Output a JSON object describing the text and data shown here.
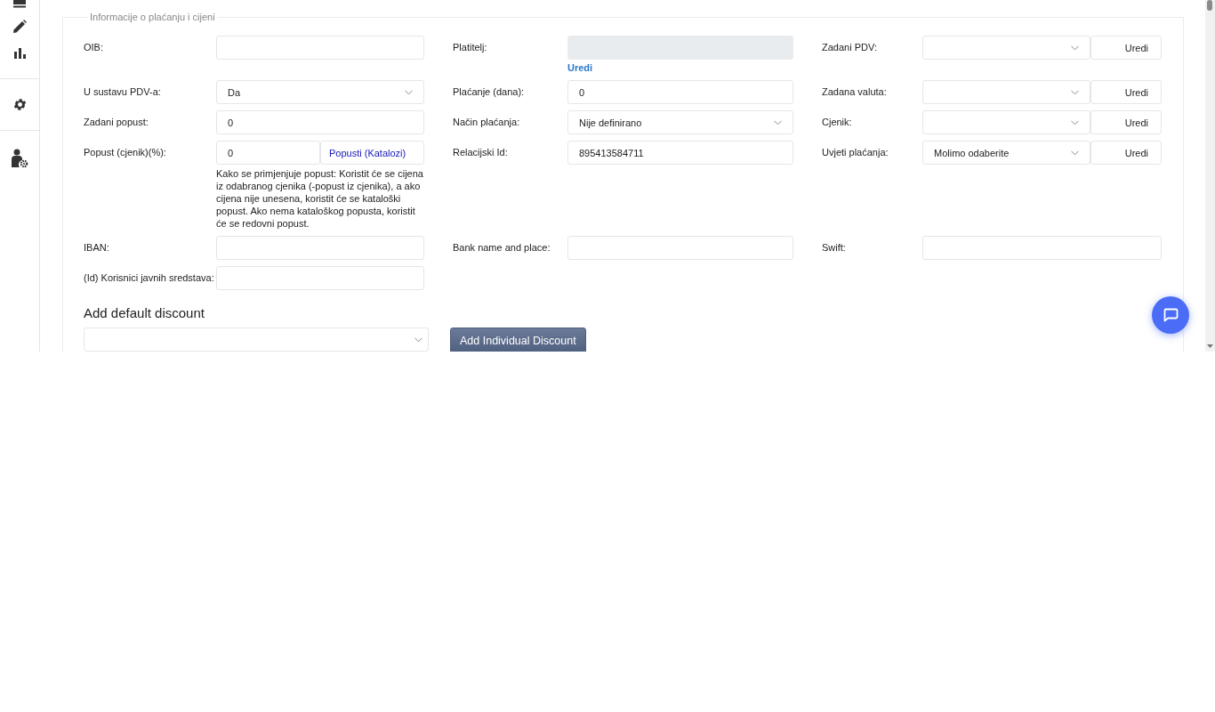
{
  "fieldset": {
    "legend": "Informacije o plaćanju i cijeni"
  },
  "rows": [
    [
      {
        "label": "OIB:",
        "kind": "input"
      },
      {
        "label": "Platitelj:",
        "kind": "readonly",
        "link": "Uredi"
      },
      {
        "label": "Zadani PDV:",
        "kind": "select",
        "edit_button": "Uredi"
      }
    ],
    [
      {
        "label": "U sustavu PDV-a:",
        "kind": "select",
        "value": "Da"
      },
      {
        "label": "Plaćanje (dana):",
        "kind": "input",
        "value": "0"
      },
      {
        "label": "Zadana valuta:",
        "kind": "select",
        "edit_button": "Uredi"
      }
    ],
    [
      {
        "label": "Zadani popust:",
        "kind": "input",
        "value": "0"
      },
      {
        "label": "Način plaćanja:",
        "kind": "select",
        "value": "Nije definirano"
      },
      {
        "label": "Cjenik:",
        "kind": "select",
        "edit_button": "Uredi"
      }
    ],
    [
      {
        "label": "Popust (cjenik)(%):",
        "kind": "input",
        "value": "0",
        "side_button": "Popusti (Katalozi)",
        "help": "Kako se primjenjuje popust: Koristit će se cijena iz odabranog cjenika (-popust iz cjenika), a ako cijena nije unesena, koristit će se kataloški popust. Ako nema kataloškog popusta, koristit će se redovni popust."
      },
      {
        "label": "Relacijski Id:",
        "kind": "input",
        "value": "895413584711"
      },
      {
        "label": "Uvjeti plaćanja:",
        "kind": "select",
        "value": "Molimo odaberite",
        "edit_button": "Uredi"
      }
    ],
    [
      {
        "label": "IBAN:",
        "kind": "input"
      },
      {
        "label": "Bank name and place:",
        "kind": "input"
      },
      {
        "label": "Swift:",
        "kind": "input"
      }
    ],
    [
      {
        "label": "(Id) Korisnici javnih sredstava:",
        "kind": "input"
      }
    ]
  ],
  "discount": {
    "heading": "Add default discount",
    "button": "Add Individual Discount"
  }
}
